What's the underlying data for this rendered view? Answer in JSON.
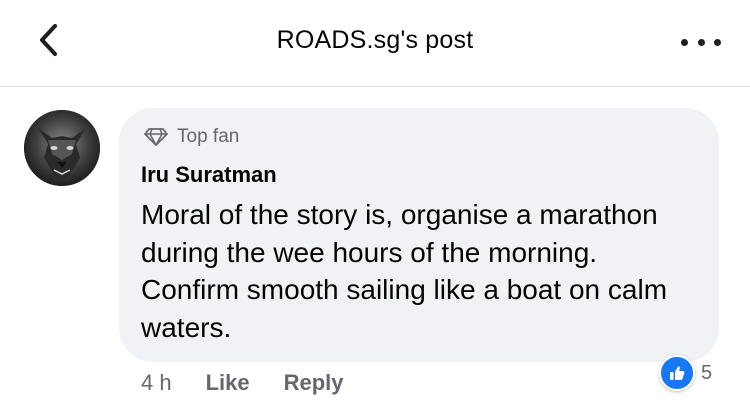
{
  "header": {
    "title": "ROADS.sg's post",
    "back_icon": "chevron-left-icon",
    "more_icon": "more-dots-icon"
  },
  "comment": {
    "badge_icon": "diamond-icon",
    "badge_label": "Top fan",
    "author": "Iru Suratman",
    "avatar_icon": "wolf-avatar",
    "text": "Moral of the story is, organise a marathon during the wee hours of the morning. Confirm smooth sailing like a boat on calm waters.",
    "time": "4 h",
    "like_label": "Like",
    "reply_label": "Reply",
    "reaction_icon": "thumbs-up-icon",
    "reaction_count": "5"
  },
  "colors": {
    "accent": "#1877f2",
    "bubble": "#f0f2f5",
    "secondary_text": "#65676b",
    "primary_text": "#050505"
  }
}
